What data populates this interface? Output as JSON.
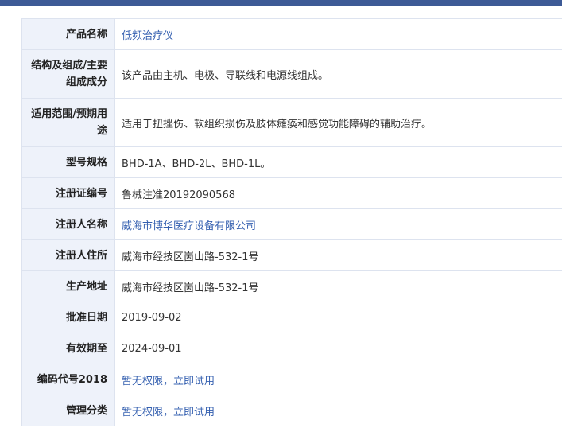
{
  "rows": [
    {
      "label": "产品名称",
      "value": "低频治疗仪",
      "link": true,
      "tall": false
    },
    {
      "label": "结构及组成/主要组成成分",
      "value": "该产品由主机、电极、导联线和电源线组成。",
      "link": false,
      "tall": true
    },
    {
      "label": "适用范围/预期用途",
      "value": "适用于扭挫伤、软组织损伤及肢体瘫痪和感觉功能障碍的辅助治疗。",
      "link": false,
      "tall": true
    },
    {
      "label": "型号规格",
      "value": "BHD-1A、BHD-2L、BHD-1L。",
      "link": false,
      "tall": false
    },
    {
      "label": "注册证编号",
      "value": "鲁械注准20192090568",
      "link": false,
      "tall": false
    },
    {
      "label": "注册人名称",
      "value": "威海市博华医疗设备有限公司",
      "link": true,
      "tall": false
    },
    {
      "label": "注册人住所",
      "value": "威海市经技区崮山路-532-1号",
      "link": false,
      "tall": false
    },
    {
      "label": "生产地址",
      "value": "威海市经技区崮山路-532-1号",
      "link": false,
      "tall": false
    },
    {
      "label": "批准日期",
      "value": "2019-09-02",
      "link": false,
      "tall": false
    },
    {
      "label": "有效期至",
      "value": "2024-09-01",
      "link": false,
      "tall": false
    },
    {
      "label": "编码代号2018",
      "value": "暂无权限，立即试用",
      "link": true,
      "tall": false
    },
    {
      "label": "管理分类",
      "value": "暂无权限，立即试用",
      "link": true,
      "tall": false
    }
  ]
}
